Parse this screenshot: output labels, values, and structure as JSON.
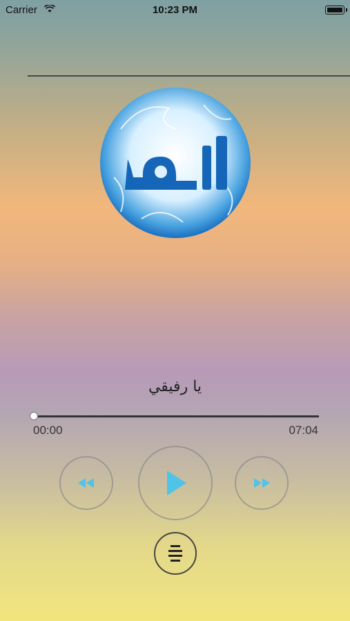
{
  "status_bar": {
    "carrier": "Carrier",
    "time": "10:23 PM"
  },
  "player": {
    "track_title": "يا رفيقي",
    "elapsed": "00:00",
    "duration": "07:04",
    "progress": 0.0
  },
  "colors": {
    "accent": "#4fc3e8",
    "icon_dark": "#222222"
  },
  "icons": {
    "artwork": "allah-calligraphy-artwork",
    "rewind": "rewind-icon",
    "play": "play-icon",
    "forward": "fast-forward-icon",
    "playlist": "playlist-icon"
  }
}
